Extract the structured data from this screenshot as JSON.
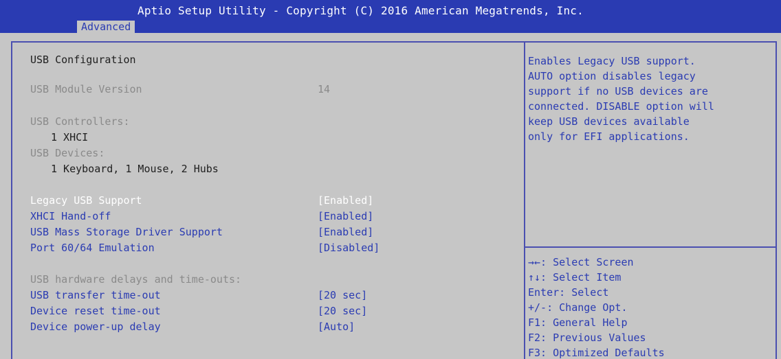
{
  "header": {
    "title": "Aptio Setup Utility - Copyright (C) 2016 American Megatrends, Inc.",
    "tab": "Advanced"
  },
  "page": {
    "heading": "USB Configuration",
    "module_version_label": "USB Module Version",
    "module_version_value": "14",
    "controllers_label": "USB Controllers:",
    "controllers_value": "1 XHCI",
    "devices_label": "USB Devices:",
    "devices_value": "1 Keyboard, 1 Mouse, 2 Hubs",
    "settings": [
      {
        "label": "Legacy USB Support",
        "value": "[Enabled]"
      },
      {
        "label": "XHCI Hand-off",
        "value": "[Enabled]"
      },
      {
        "label": "USB Mass Storage Driver Support",
        "value": "[Enabled]"
      },
      {
        "label": "Port 60/64 Emulation",
        "value": "[Disabled]"
      }
    ],
    "delays_heading": "USB hardware delays and time-outs:",
    "delays": [
      {
        "label": "USB transfer time-out",
        "value": "[20 sec]"
      },
      {
        "label": "Device reset time-out",
        "value": "[20 sec]"
      },
      {
        "label": "Device power-up delay",
        "value": "[Auto]"
      }
    ]
  },
  "help": {
    "lines": [
      "Enables Legacy USB support.",
      "AUTO option disables legacy",
      "support if no USB devices are",
      "connected. DISABLE option will",
      "keep USB devices available",
      "only for EFI applications."
    ]
  },
  "keys": [
    "→←: Select Screen",
    "↑↓: Select Item",
    "Enter: Select",
    "+/-: Change Opt.",
    "F1: General Help",
    "F2: Previous Values",
    "F3: Optimized Defaults"
  ],
  "colors": {
    "title_bar": "#2a3bb2",
    "background": "#c6c6c6",
    "selected_item": "#ffffff",
    "item_text": "#2a3bb2",
    "static_text": "#202020",
    "disabled_text": "#8a8a8a"
  }
}
